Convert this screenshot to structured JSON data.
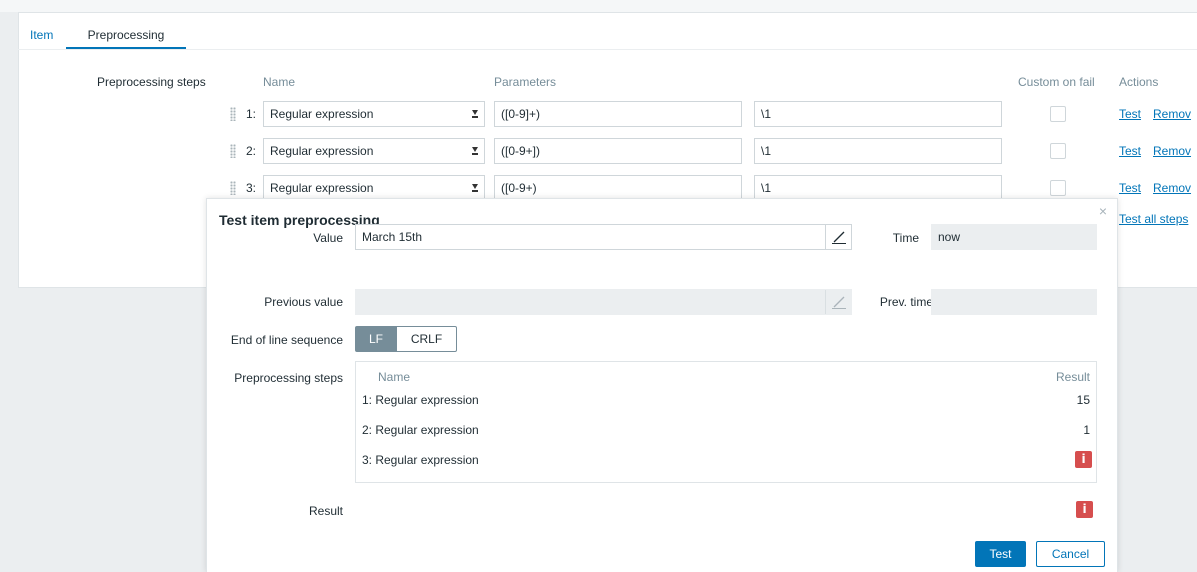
{
  "tabs": [
    {
      "label": "Item"
    },
    {
      "label": "Preprocessing"
    }
  ],
  "form": {
    "steps_label": "Preprocessing steps",
    "headers": {
      "name": "Name",
      "parameters": "Parameters",
      "custom_on_fail": "Custom on fail",
      "actions": "Actions"
    },
    "steps": [
      {
        "num": "1:",
        "name": "Regular expression",
        "param1": "([0-9]+)",
        "param2": "\\1",
        "custom_on_fail": false,
        "test": "Test",
        "remove": "Remov"
      },
      {
        "num": "2:",
        "name": "Regular expression",
        "param1": "([0-9+])",
        "param2": "\\1",
        "custom_on_fail": false,
        "test": "Test",
        "remove": "Remov"
      },
      {
        "num": "3:",
        "name": "Regular expression",
        "param1": "([0-9+)",
        "param2": "\\1",
        "custom_on_fail": false,
        "test": "Test",
        "remove": "Remov"
      }
    ],
    "test_all_label": "Test all steps"
  },
  "modal": {
    "title": "Test item preprocessing",
    "close_icon": "×",
    "value_label": "Value",
    "value": "March 15th",
    "time_label": "Time",
    "time_value": "now",
    "prev_value_label": "Previous value",
    "prev_value": "",
    "prev_time_label": "Prev. time",
    "prev_time_value": "",
    "eol_label": "End of line sequence",
    "eol_options": [
      "LF",
      "CRLF"
    ],
    "eol_selected": "LF",
    "steps_label": "Preprocessing steps",
    "steps_headers": {
      "name": "Name",
      "result": "Result"
    },
    "steps": [
      {
        "label": "1: Regular expression",
        "result": "15"
      },
      {
        "label": "2: Regular expression",
        "result": "1"
      },
      {
        "label": "3: Regular expression",
        "result_icon": "info-error-icon"
      }
    ],
    "result_label": "Result",
    "result_icon": "info-error-icon",
    "test_button": "Test",
    "cancel_button": "Cancel"
  },
  "colors": {
    "accent": "#0275b8",
    "error": "#d64e4e",
    "overlay": "#ebeef0"
  }
}
